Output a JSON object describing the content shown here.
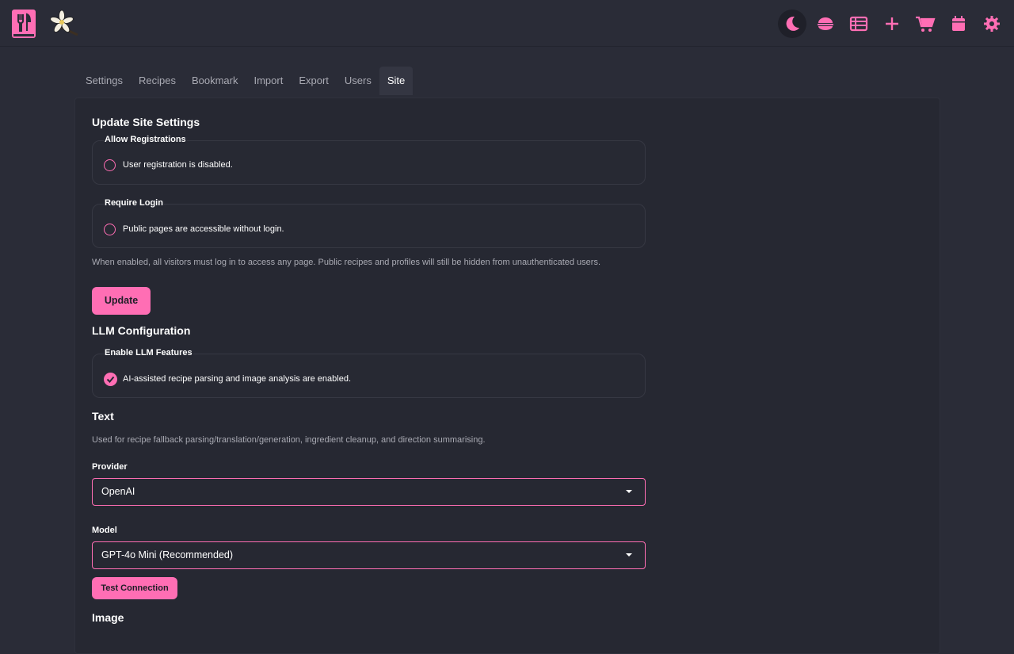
{
  "header": {
    "icons": [
      "utensils-book-logo",
      "vanilla-flower-logo",
      "moon-icon",
      "bowl-icon",
      "table-icon",
      "plus-icon",
      "cart-icon",
      "calendar-icon",
      "gear-icon"
    ]
  },
  "tabs": [
    {
      "label": "Settings"
    },
    {
      "label": "Recipes"
    },
    {
      "label": "Bookmark"
    },
    {
      "label": "Import"
    },
    {
      "label": "Export"
    },
    {
      "label": "Users"
    },
    {
      "label": "Site",
      "active": true
    }
  ],
  "site_settings": {
    "title": "Update Site Settings",
    "allow_registrations": {
      "legend": "Allow Registrations",
      "option": "User registration is disabled."
    },
    "require_login": {
      "legend": "Require Login",
      "option": "Public pages are accessible without login."
    },
    "help": "When enabled, all visitors must log in to access any page. Public recipes and profiles will still be hidden from unauthenticated users.",
    "update_button": "Update"
  },
  "llm": {
    "title": "LLM Configuration",
    "enable": {
      "legend": "Enable LLM Features",
      "option": "AI-assisted recipe parsing and image analysis are enabled."
    },
    "text_title": "Text",
    "text_help": "Used for recipe fallback parsing/translation/generation, ingredient cleanup, and direction summarising.",
    "provider_label": "Provider",
    "provider_value": "OpenAI",
    "model_label": "Model",
    "model_value": "GPT-4o Mini (Recommended)",
    "test_button": "Test Connection",
    "image_title": "Image"
  },
  "colors": {
    "accent": "#ff6eb4",
    "background": "#2a2c37",
    "panel": "#262832"
  }
}
